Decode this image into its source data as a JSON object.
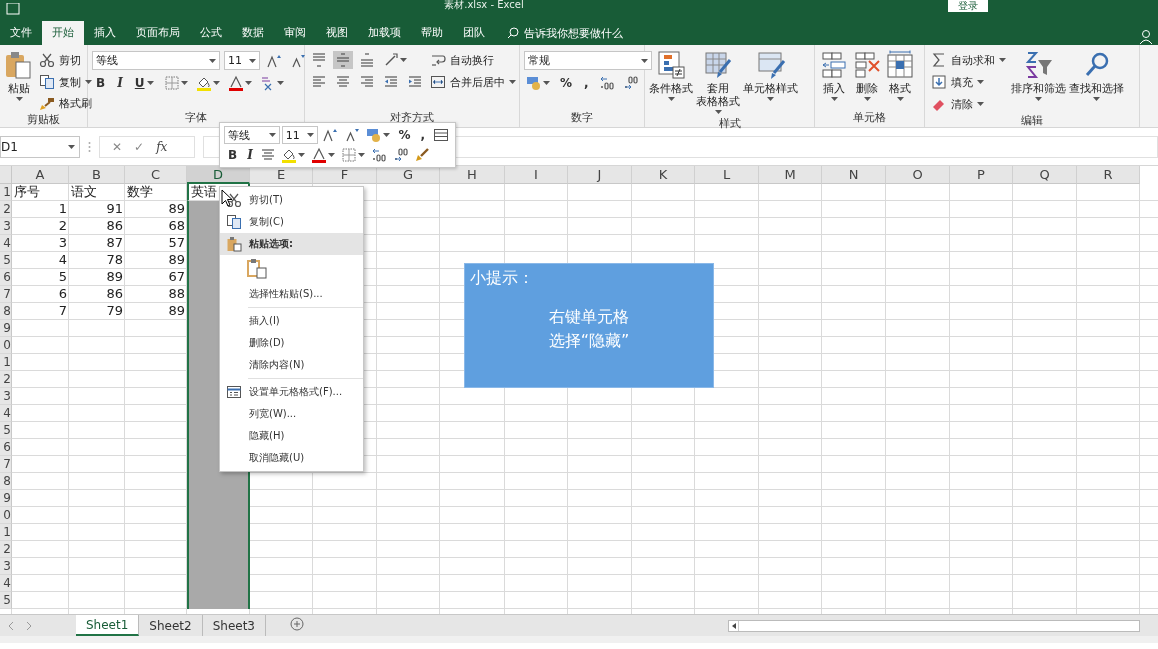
{
  "title_bar": {
    "title": "素材.xlsx  -  Excel",
    "login": "登录"
  },
  "tabs": [
    {
      "label": "文件",
      "selected": false
    },
    {
      "label": "开始",
      "selected": true
    },
    {
      "label": "插入",
      "selected": false
    },
    {
      "label": "页面布局",
      "selected": false
    },
    {
      "label": "公式",
      "selected": false
    },
    {
      "label": "数据",
      "selected": false
    },
    {
      "label": "审阅",
      "selected": false
    },
    {
      "label": "视图",
      "selected": false
    },
    {
      "label": "加载项",
      "selected": false
    },
    {
      "label": "帮助",
      "selected": false
    },
    {
      "label": "团队",
      "selected": false
    }
  ],
  "search": {
    "placeholder": "告诉我你想要做什么"
  },
  "ribbon": [
    {
      "label": "剪贴板",
      "blocks": [
        {
          "kind": "large",
          "label": "粘贴",
          "dropdown": true
        },
        {
          "kind": "stack",
          "rows": [
            [
              {
                "kind": "labeled",
                "label": "剪切"
              }
            ],
            [
              {
                "kind": "labeled",
                "label": "复制",
                "dropdown": true
              }
            ],
            [
              {
                "kind": "labeled",
                "label": "格式刷"
              }
            ]
          ]
        }
      ]
    },
    {
      "label": "字体",
      "blocks": [
        {
          "kind": "stack",
          "rows": [
            [
              {
                "kind": "combo",
                "value": "等线"
              },
              {
                "kind": "combo",
                "value": "11"
              },
              {
                "kind": "icon"
              },
              {
                "kind": "icon"
              }
            ],
            [
              {
                "kind": "text",
                "label": "B"
              },
              {
                "kind": "text",
                "label": "I"
              },
              {
                "kind": "text",
                "label": "U",
                "dropdown": true
              },
              {
                "kind": "icon",
                "dropdown": true
              },
              {
                "kind": "icon",
                "dropdown": true
              },
              {
                "kind": "icon",
                "dropdown": true
              },
              {
                "kind": "icon",
                "dropdown": true
              }
            ]
          ]
        }
      ]
    },
    {
      "label": "对齐方式",
      "blocks": [
        {
          "kind": "stack",
          "rows": [
            [
              {
                "kind": "icon",
                "pressed": false
              },
              {
                "kind": "icon",
                "pressed": true
              },
              {
                "kind": "icon",
                "pressed": false
              },
              {
                "kind": "icon",
                "dropdown": true,
                "pressed": false
              }
            ],
            [
              {
                "kind": "icon"
              },
              {
                "kind": "icon"
              },
              {
                "kind": "icon"
              },
              {
                "kind": "icon"
              },
              {
                "kind": "icon"
              }
            ]
          ]
        },
        {
          "kind": "stack",
          "rows": [
            [
              {
                "kind": "labeled",
                "label": "自动换行"
              }
            ],
            [
              {
                "kind": "labeled",
                "label": "合并后居中",
                "dropdown": true
              }
            ]
          ]
        }
      ]
    },
    {
      "label": "数字",
      "blocks": [
        {
          "kind": "stack",
          "rows": [
            [
              {
                "kind": "combo",
                "value": "常规"
              }
            ],
            [
              {
                "kind": "icon",
                "dropdown": true
              },
              {
                "kind": "text",
                "label": "%"
              },
              {
                "kind": "text",
                "label": ","
              },
              {
                "kind": "icon"
              },
              {
                "kind": "icon"
              }
            ]
          ]
        }
      ]
    },
    {
      "label": "样式",
      "blocks": [
        {
          "kind": "large",
          "label": "条件格式",
          "dropdown": true
        },
        {
          "kind": "large",
          "lines": [
            "套用",
            "表格格式"
          ],
          "dropdown": true
        },
        {
          "kind": "large",
          "label": "单元格样式",
          "dropdown": true
        }
      ]
    },
    {
      "label": "单元格",
      "blocks": [
        {
          "kind": "large",
          "label": "插入",
          "dropdown": true
        },
        {
          "kind": "large",
          "label": "删除",
          "dropdown": true
        },
        {
          "kind": "large",
          "label": "格式",
          "dropdown": true
        }
      ]
    },
    {
      "label": "编辑",
      "blocks": [
        {
          "kind": "stack",
          "rows": [
            [
              {
                "kind": "labeled",
                "label": "自动求和",
                "dropdown": true
              }
            ],
            [
              {
                "kind": "labeled",
                "label": "填充",
                "dropdown": true
              }
            ],
            [
              {
                "kind": "labeled",
                "label": "清除",
                "dropdown": true
              }
            ]
          ]
        },
        {
          "kind": "large",
          "label": "排序和筛选",
          "dropdown": true
        },
        {
          "kind": "large",
          "label": "查找和选择",
          "dropdown": true
        }
      ]
    }
  ],
  "formula_bar": {
    "name_box": "D1",
    "buttons": [
      "✕",
      "✓",
      "fx"
    ]
  },
  "columns": [
    {
      "label": "A",
      "selected": false
    },
    {
      "label": "B",
      "selected": false
    },
    {
      "label": "C",
      "selected": false
    },
    {
      "label": "D",
      "selected": true
    },
    {
      "label": "E",
      "selected": false
    },
    {
      "label": "F",
      "selected": false
    },
    {
      "label": "G",
      "selected": false
    },
    {
      "label": "H",
      "selected": false
    },
    {
      "label": "I",
      "selected": false
    },
    {
      "label": "J",
      "selected": false
    },
    {
      "label": "K",
      "selected": false
    },
    {
      "label": "L",
      "selected": false
    },
    {
      "label": "M",
      "selected": false
    },
    {
      "label": "N",
      "selected": false
    },
    {
      "label": "O",
      "selected": false
    },
    {
      "label": "P",
      "selected": false
    },
    {
      "label": "Q",
      "selected": false
    },
    {
      "label": "R",
      "selected": false
    }
  ],
  "rows": [
    {
      "number": "1",
      "kind": "header",
      "cells": [
        "序号",
        "语文",
        "数学",
        "英语"
      ]
    },
    {
      "number": "2",
      "kind": "data",
      "cells": [
        "1",
        "91",
        "89"
      ]
    },
    {
      "number": "3",
      "kind": "data",
      "cells": [
        "2",
        "86",
        "68"
      ]
    },
    {
      "number": "4",
      "kind": "data",
      "cells": [
        "3",
        "87",
        "57"
      ]
    },
    {
      "number": "5",
      "kind": "data",
      "cells": [
        "4",
        "78",
        "89"
      ]
    },
    {
      "number": "6",
      "kind": "data",
      "cells": [
        "5",
        "89",
        "67"
      ]
    },
    {
      "number": "7",
      "kind": "data",
      "cells": [
        "6",
        "86",
        "88"
      ]
    },
    {
      "number": "8",
      "kind": "data",
      "cells": [
        "7",
        "79",
        "89"
      ]
    },
    {
      "number": "9"
    },
    {
      "number": "0"
    },
    {
      "number": "1"
    },
    {
      "number": "2"
    },
    {
      "number": "3"
    },
    {
      "number": "4"
    },
    {
      "number": "5"
    },
    {
      "number": "6"
    },
    {
      "number": "7"
    },
    {
      "number": "8"
    },
    {
      "number": "9"
    },
    {
      "number": "0"
    },
    {
      "number": "1"
    },
    {
      "number": "2"
    },
    {
      "number": "3"
    },
    {
      "number": "4"
    },
    {
      "number": "5"
    }
  ],
  "mini_toolbar": [
    [
      {
        "kind": "combo",
        "value": "等线"
      },
      {
        "kind": "combo",
        "value": "11"
      },
      {
        "kind": "icon"
      },
      {
        "kind": "icon"
      },
      {
        "kind": "icon",
        "dropdown": true
      },
      {
        "kind": "text",
        "label": "%"
      },
      {
        "kind": "text",
        "label": ","
      },
      {
        "kind": "icon"
      }
    ],
    [
      {
        "kind": "text",
        "label": "B"
      },
      {
        "kind": "text",
        "label": "I"
      },
      {
        "kind": "icon"
      },
      {
        "kind": "icon",
        "dropdown": true
      },
      {
        "kind": "icon",
        "dropdown": true
      },
      {
        "kind": "icon",
        "dropdown": true
      },
      {
        "kind": "icon"
      },
      {
        "kind": "icon"
      },
      {
        "kind": "icon"
      }
    ]
  ],
  "context_menu": [
    {
      "kind": "item",
      "label": "剪切(T)",
      "icon": true,
      "selected": false
    },
    {
      "kind": "item",
      "label": "复制(C)",
      "icon": true,
      "selected": false
    },
    {
      "kind": "header",
      "label": "粘贴选项:",
      "icon": true,
      "selected": true
    },
    {
      "kind": "paste-option"
    },
    {
      "kind": "item",
      "label": "选择性粘贴(S)...",
      "icon": false,
      "selected": false
    },
    {
      "kind": "separator"
    },
    {
      "kind": "item",
      "label": "插入(I)",
      "icon": false,
      "selected": false
    },
    {
      "kind": "item",
      "label": "删除(D)",
      "icon": false,
      "selected": false
    },
    {
      "kind": "item",
      "label": "清除内容(N)",
      "icon": false,
      "selected": false
    },
    {
      "kind": "separator"
    },
    {
      "kind": "item",
      "label": "设置单元格格式(F)...",
      "icon": true,
      "selected": false
    },
    {
      "kind": "item",
      "label": "列宽(W)...",
      "icon": false,
      "selected": false
    },
    {
      "kind": "item",
      "label": "隐藏(H)",
      "icon": false,
      "selected": false
    },
    {
      "kind": "item",
      "label": "取消隐藏(U)",
      "icon": false,
      "selected": false
    }
  ],
  "tip_box": {
    "title": "小提示：",
    "lines": [
      "右键单元格",
      "选择“隐藏”"
    ]
  },
  "sheet_tabs": [
    {
      "label": "Sheet1",
      "selected": true
    },
    {
      "label": "Sheet2",
      "selected": false
    },
    {
      "label": "Sheet3",
      "selected": false
    }
  ]
}
